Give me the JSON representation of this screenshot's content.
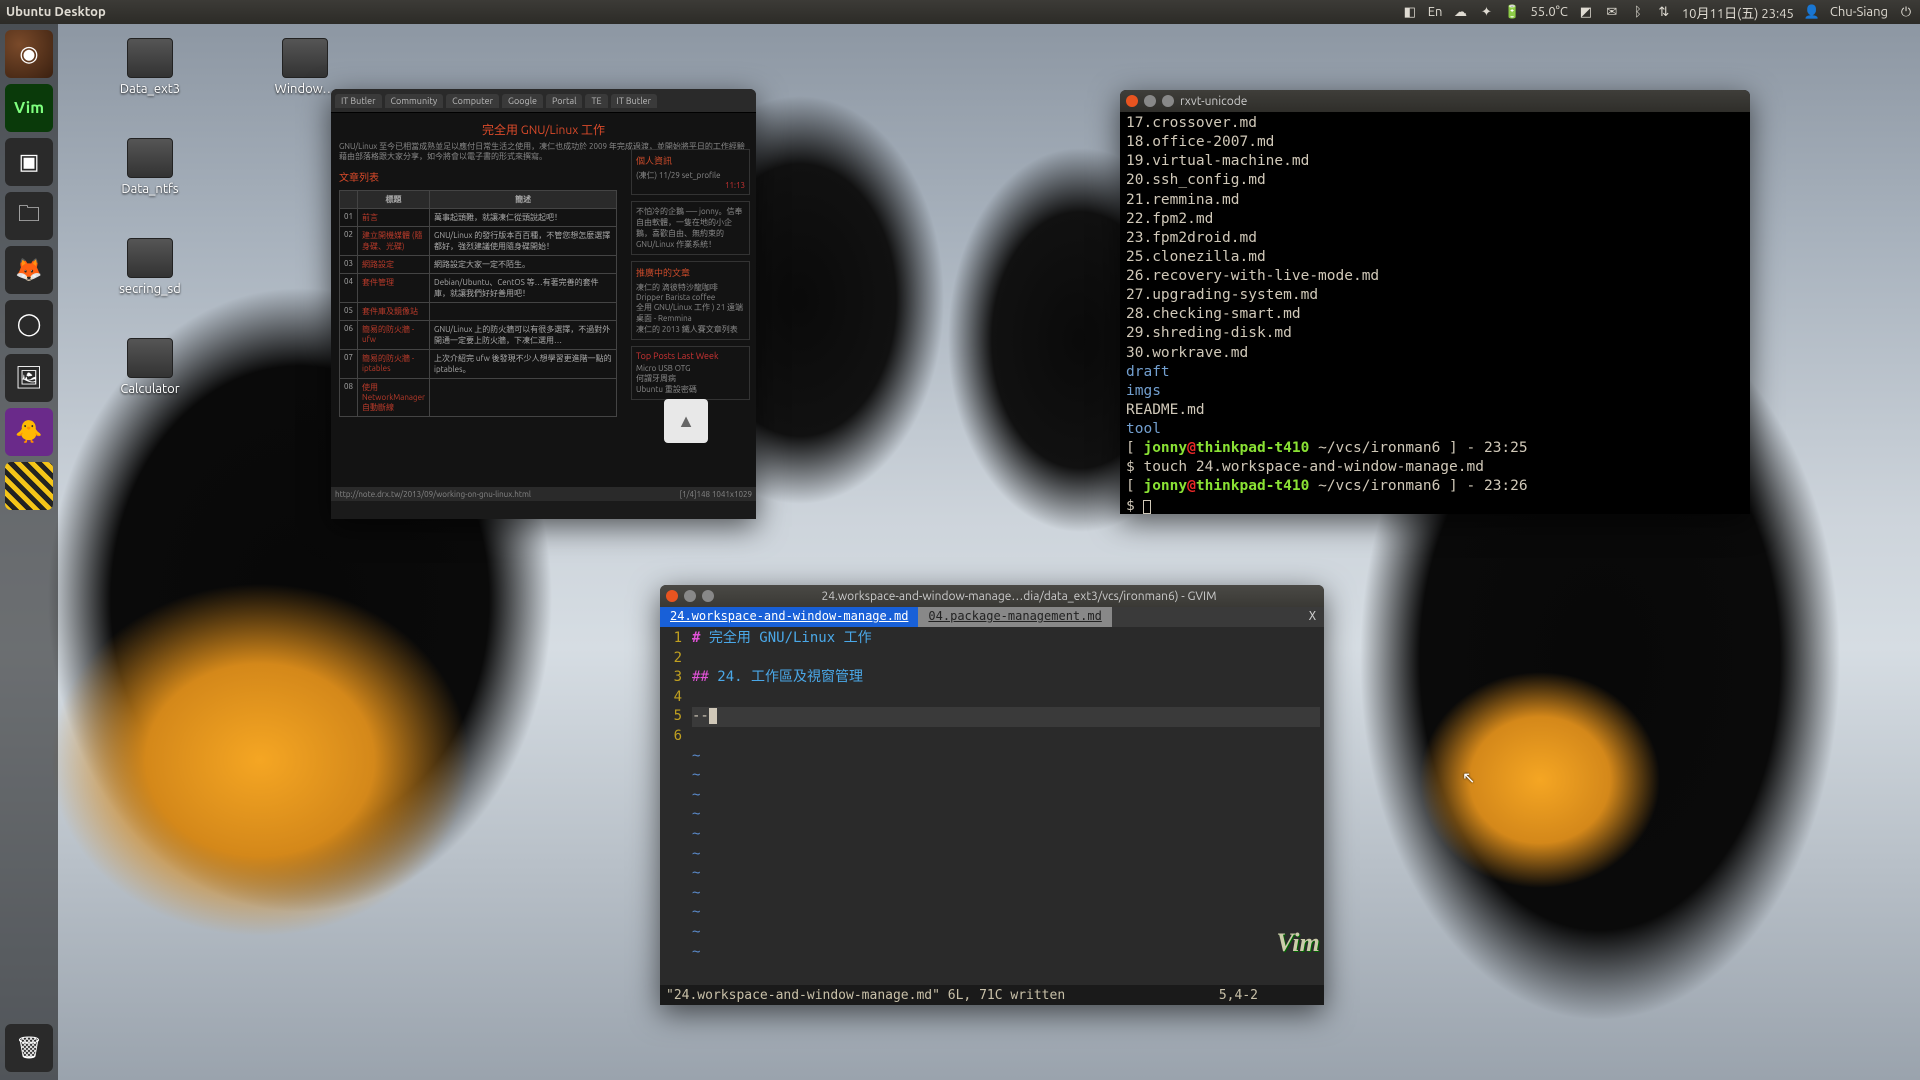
{
  "panel": {
    "title": "Ubuntu Desktop",
    "lang": "En",
    "temp": "55.0°C",
    "date": "10月11日(五) 23:45",
    "user": "Chu-Siang"
  },
  "desktop_icons": [
    {
      "label": "Data_ext3"
    },
    {
      "label": "Data_ntfs"
    },
    {
      "label": "secring_sd"
    },
    {
      "label": "Calculator"
    },
    {
      "label": "Window…"
    }
  ],
  "browser": {
    "tabs": [
      "IT Butler",
      "Community",
      "Computer",
      "Google",
      "Portal",
      "TE",
      "IT Butler"
    ],
    "title": "完全用 GNU/Linux 工作",
    "subtitle": "GNU/Linux 至今已相當成熟並足以應付日常生活之使用，凍仁也成功於 2009 年完成過渡，並開始將平日的工作經驗藉由部落格跟大家分享，如今將會以電子書的形式來撰寫。",
    "section": "文章列表",
    "th": [
      "",
      "標題",
      "簡述"
    ],
    "rows": [
      {
        "n": "01",
        "t": "前言",
        "d": "萬事起頭難，就讓凍仁從頭說起吧！"
      },
      {
        "n": "02",
        "t": "建立開機媒體 (隨身碟、光碟)",
        "d": "GNU/Linux 的發行版本百百種，不管您想怎麼選擇都好，強烈建議使用隨身碟開始！"
      },
      {
        "n": "03",
        "t": "網路設定",
        "d": "網路設定大家一定不陌生。"
      },
      {
        "n": "04",
        "t": "套件管理",
        "d": "Debian/Ubuntu、CentOS 等…有著完善的套件庫，就讓我們好好善用吧！"
      },
      {
        "n": "05",
        "t": "套件庫及鏡像站",
        "d": ""
      },
      {
        "n": "06",
        "t": "簡易的防火牆 - ufw",
        "d": "GNU/Linux 上的防火牆可以有很多選擇，不過對外開通一定要上防火牆，下凍仁選用…"
      },
      {
        "n": "07",
        "t": "簡易的防火牆 - iptables",
        "d": "上次介紹完 ufw 後發現不少人想學習更進階一點的 iptables。"
      },
      {
        "n": "08",
        "t": "使用 NetworkManager 自動斷線",
        "d": ""
      }
    ],
    "side": {
      "profile_hd": "個人資訊",
      "profile_body": "(凍仁) 11/29 set_profile",
      "time": "11:13",
      "about": "不怕冷的企鵝 ── jonny。信奉自由軟體，一隻在地的小企鵝，喜歡自由、無約束的GNU/Linux 作業系統！",
      "promo_hd": "推廣中的文章",
      "promo": [
        "凍仁的 滴彼特沙龍咖啡 Dripper Barista coffee",
        "全用 GNU/Linux 工作 ) 21 遠端桌面 - Remmina",
        "凍仁的 2013 鐵人賽文章列表"
      ],
      "top_hd": "Top Posts Last Week",
      "top": [
        "Micro USB OTG",
        "何謂牙周病",
        "Ubuntu 重設密碼"
      ]
    },
    "status_url": "http://note.drx.tw/2013/09/working-on-gnu-linux.html",
    "status_dim": "[1/4]148 1041x1029"
  },
  "terminal": {
    "title": "rxvt-unicode",
    "files": [
      "17.crossover.md",
      "18.office-2007.md",
      "19.virtual-machine.md",
      "20.ssh_config.md",
      "21.remmina.md",
      "22.fpm2.md",
      "23.fpm2droid.md",
      "25.clonezilla.md",
      "26.recovery-with-live-mode.md",
      "27.upgrading-system.md",
      "28.checking-smart.md",
      "29.shreding-disk.md",
      "30.workrave.md"
    ],
    "dirs": [
      "draft",
      "imgs"
    ],
    "readme": "README.md",
    "dir2": "tool",
    "user": "jonny",
    "host": "thinkpad-t410",
    "path": "~/vcs/ironman6",
    "time1": "23:25",
    "cmd": "touch 24.workspace-and-window-manage.md",
    "time2": "23:26"
  },
  "gvim": {
    "title": "24.workspace-and-window-manage…dia/data_ext3/vcs/ironman6) - GVIM",
    "tab_active": "24.workspace-and-window-manage.md",
    "tab_inactive": "04.package-management.md",
    "lines": {
      "1": {
        "prefix": "# ",
        "text": "完全用 GNU/Linux 工作"
      },
      "3": {
        "prefix": "## ",
        "text": "24. 工作區及視窗管理"
      },
      "5": "--"
    },
    "status": "\"24.workspace-and-window-manage.md\" 6L, 71C written",
    "pos": "5,4-2"
  }
}
